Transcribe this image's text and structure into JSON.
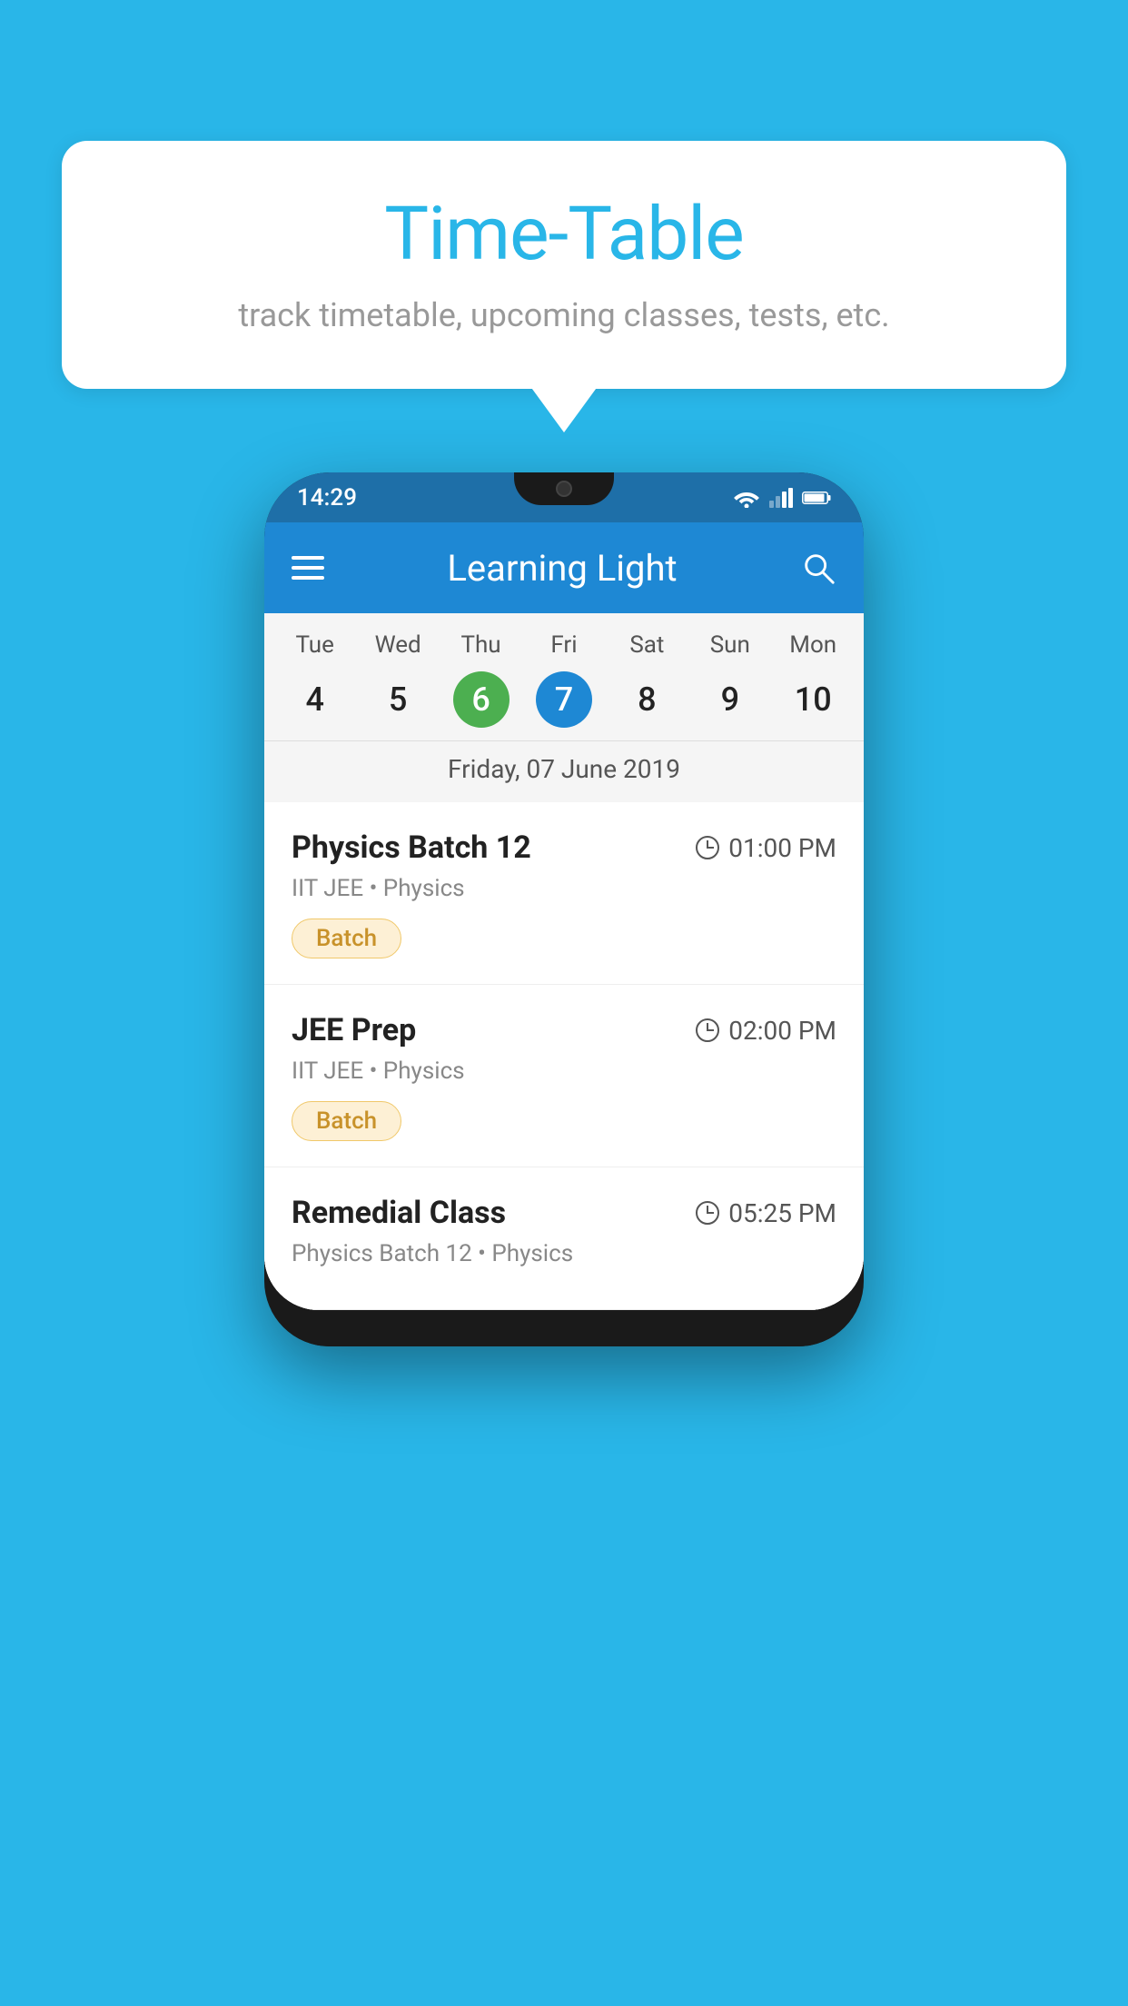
{
  "page": {
    "background_color": "#29b6e8"
  },
  "speech_bubble": {
    "title": "Time-Table",
    "subtitle": "track timetable, upcoming classes, tests, etc."
  },
  "app": {
    "name": "Learning Light",
    "time": "14:29"
  },
  "calendar": {
    "selected_date_label": "Friday, 07 June 2019",
    "days": [
      {
        "name": "Tue",
        "number": "4",
        "state": "normal"
      },
      {
        "name": "Wed",
        "number": "5",
        "state": "normal"
      },
      {
        "name": "Thu",
        "number": "6",
        "state": "today"
      },
      {
        "name": "Fri",
        "number": "7",
        "state": "selected"
      },
      {
        "name": "Sat",
        "number": "8",
        "state": "normal"
      },
      {
        "name": "Sun",
        "number": "9",
        "state": "normal"
      },
      {
        "name": "Mon",
        "number": "10",
        "state": "normal"
      }
    ]
  },
  "classes": [
    {
      "name": "Physics Batch 12",
      "time": "01:00 PM",
      "subtitle": "IIT JEE • Physics",
      "badge": "Batch"
    },
    {
      "name": "JEE Prep",
      "time": "02:00 PM",
      "subtitle": "IIT JEE • Physics",
      "badge": "Batch"
    },
    {
      "name": "Remedial Class",
      "time": "05:25 PM",
      "subtitle": "Physics Batch 12 • Physics",
      "badge": null
    }
  ],
  "icons": {
    "hamburger": "menu",
    "search": "search",
    "clock": "clock"
  }
}
